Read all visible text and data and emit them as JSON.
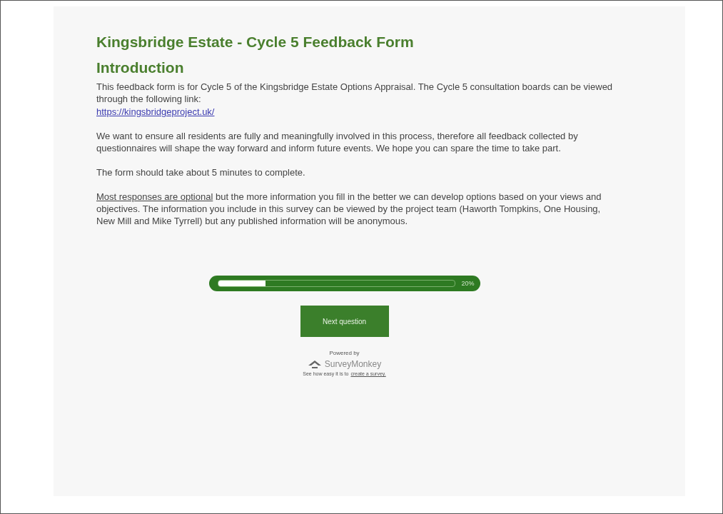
{
  "title": "Kingsbridge Estate - Cycle 5 Feedback Form",
  "section": "Introduction",
  "intro": {
    "text": "This feedback form is for Cycle 5 of the Kingsbridge Estate Options Appraisal. The Cycle 5 consultation boards can be viewed through the following link:",
    "link": "https://kingsbridgeproject.uk/"
  },
  "paragraphs": [
    "We want to ensure all residents are fully and meaningfully involved in this process, therefore all feedback collected by questionnaires will shape the way forward and inform future events. We hope you can spare the time to take part.",
    "The form should take about 5 minutes to complete."
  ],
  "notice": {
    "underlined": "Most responses are optional",
    "text": " but the more information you fill in the better we can develop options based on your views and objectives. The information you include in this survey can be viewed by the project team (Haworth Tompkins, One Housing, New Mill and Mike Tyrrell) but any published information will be anonymous."
  },
  "progress": {
    "level": 0.2,
    "reading": "20%"
  },
  "next_button": "Next question",
  "footer": {
    "powered_by": "Powered by",
    "brand": "SurveyMonkey",
    "tagline": "See how easy it is to",
    "tagline_link": "create a survey."
  }
}
